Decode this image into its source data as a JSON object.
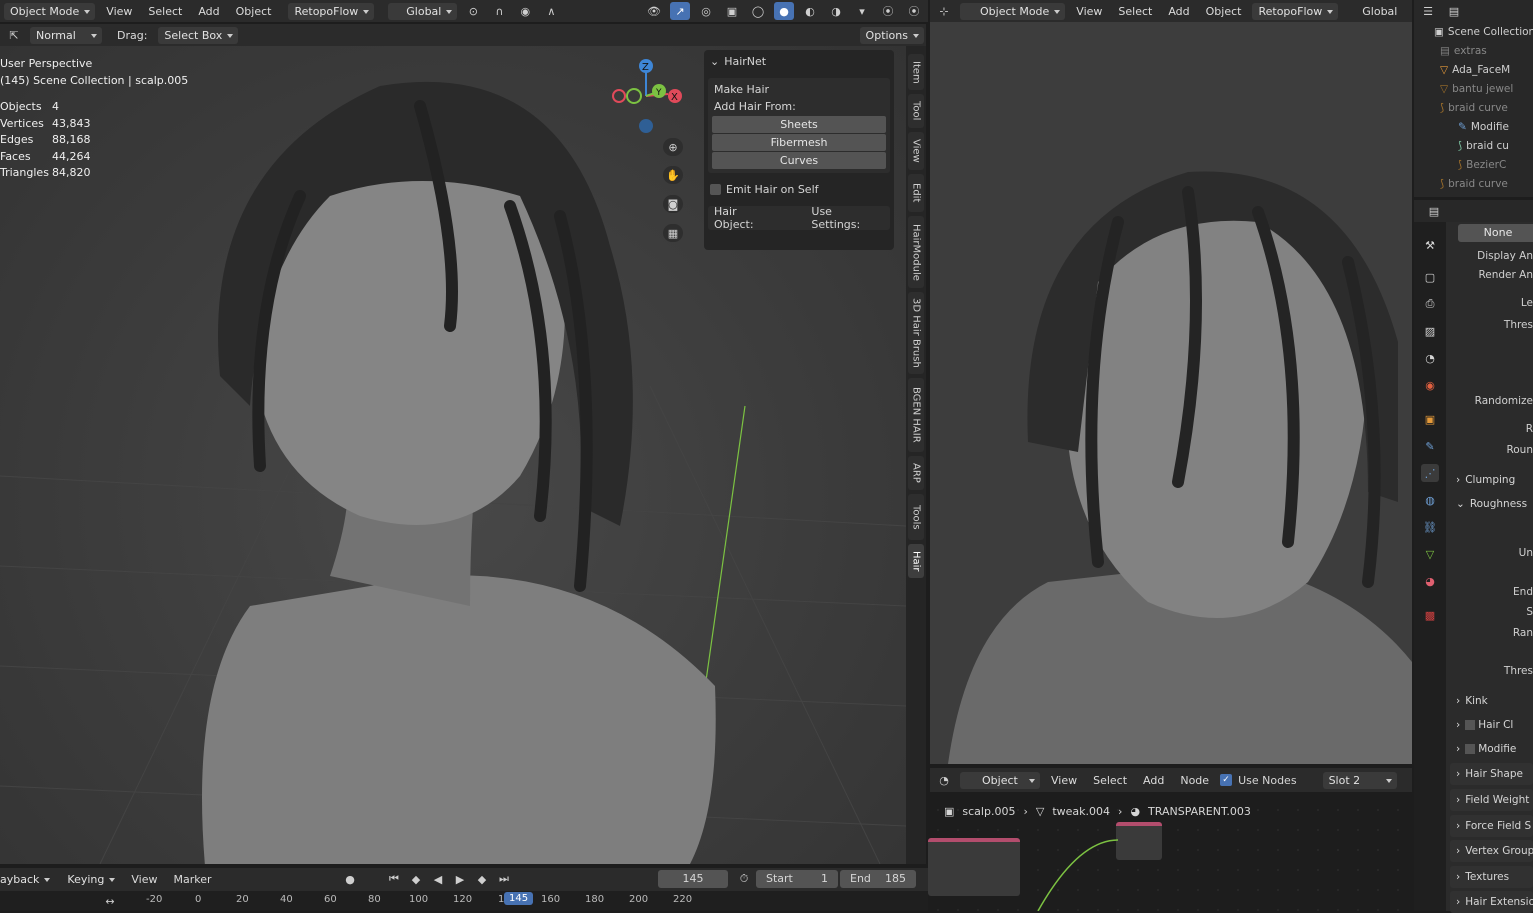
{
  "left_header": {
    "mode": "Object Mode",
    "menus": [
      "View",
      "Select",
      "Add",
      "Object"
    ],
    "addon": "RetopoFlow",
    "orientation": "Global"
  },
  "tool_header": {
    "brush": "Normal",
    "drag_label": "Drag:",
    "drag_value": "Select Box",
    "options": "Options"
  },
  "viewport_left": {
    "perspective": "User Perspective",
    "collection": "(145) Scene Collection | scalp.005",
    "stats": [
      {
        "k": "Objects",
        "v": "4"
      },
      {
        "k": "Vertices",
        "v": "43,843"
      },
      {
        "k": "Edges",
        "v": "88,168"
      },
      {
        "k": "Faces",
        "v": "44,264"
      },
      {
        "k": "Triangles",
        "v": "84,820"
      }
    ],
    "gizmo": {
      "z": "Z",
      "y": "Y",
      "x": "X"
    }
  },
  "hairnet": {
    "title": "HairNet",
    "make_hair": "Make Hair",
    "add_from": "Add Hair From:",
    "buttons": [
      "Sheets",
      "Fibermesh",
      "Curves"
    ],
    "emit_self": "Emit Hair on Self",
    "hair_object": "Hair Object:",
    "use_settings": "Use Settings:"
  },
  "side_tabs": [
    "Item",
    "Tool",
    "View",
    "Edit",
    "HairModule",
    "3D Hair Brush",
    "BGEN HAIR",
    "ARP",
    "Tools",
    "Hair"
  ],
  "right_header": {
    "mode": "Object Mode",
    "menus": [
      "View",
      "Select",
      "Add",
      "Object"
    ],
    "addon": "RetopoFlow",
    "orientation": "Global"
  },
  "node_header": {
    "type": "Object",
    "menus": [
      "View",
      "Select",
      "Add",
      "Node"
    ],
    "use_nodes": "Use Nodes",
    "slot": "Slot 2"
  },
  "breadcrumb": [
    "scalp.005",
    "tweak.004",
    "TRANSPARENT.003"
  ],
  "outliner": [
    {
      "label": "Scene Collection",
      "indent": 0
    },
    {
      "label": "extras",
      "indent": 1
    },
    {
      "label": "Ada_FaceM",
      "indent": 1
    },
    {
      "label": "bantu jewel",
      "indent": 1
    },
    {
      "label": "braid curve",
      "indent": 1
    },
    {
      "label": "Modifie",
      "indent": 2
    },
    {
      "label": "braid cu",
      "indent": 2
    },
    {
      "label": "BezierC",
      "indent": 2
    },
    {
      "label": "braid curve",
      "indent": 1
    }
  ],
  "properties": {
    "none": "None",
    "rows": [
      "Display An",
      "Render An",
      "Le",
      "Thres",
      "Randomize",
      "R",
      "Roun",
      "Un",
      "End",
      "S",
      "Ran",
      "Thres"
    ],
    "sections": [
      "Clumping",
      "Roughness",
      "Kink",
      "Hair Cl",
      "Modifie",
      "Hair Shape",
      "Field Weight",
      "Force Field S",
      "Vertex Group",
      "Textures",
      "Hair Extensio"
    ]
  },
  "timeline": {
    "menus": [
      "ayback",
      "Keying",
      "View",
      "Marker"
    ],
    "frame": "145",
    "start_label": "Start",
    "start": "1",
    "end_label": "End",
    "end": "185",
    "ticks": [
      "-20",
      "0",
      "20",
      "40",
      "60",
      "80",
      "100",
      "120",
      "1",
      "145",
      "160",
      "180",
      "200",
      "220"
    ]
  },
  "colors": {
    "accent": "#4772b3",
    "x_axis": "#e04a5a",
    "y_axis": "#7cc242",
    "z_axis": "#3e86d6"
  }
}
